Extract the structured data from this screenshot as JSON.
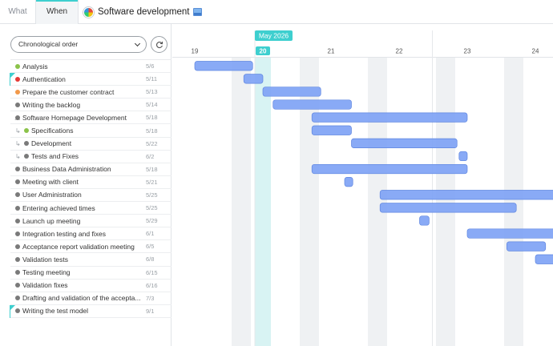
{
  "tabs": [
    {
      "label": "What"
    },
    {
      "label": "When"
    }
  ],
  "project": {
    "title": "Software development"
  },
  "left_panel": {
    "order_select": "Chronological order"
  },
  "timeline": {
    "month_label": "May 2026",
    "days": [
      "19",
      "20",
      "21",
      "22",
      "23",
      "24"
    ],
    "today": "20",
    "accent_color": "#3ecfcf",
    "bar_color": "#7fa3f5"
  },
  "tasks": [
    {
      "name": "Analysis",
      "date": "5/6",
      "dot": "#8bc34a",
      "start": 19.0,
      "end": 19.85
    },
    {
      "name": "Authentication",
      "date": "5/11",
      "dot": "#e53935",
      "flag": true,
      "start": 19.72,
      "end": 20.0
    },
    {
      "name": "Prepare the customer contract",
      "date": "5/13",
      "dot": "#f2994a",
      "start": 20.0,
      "end": 20.85
    },
    {
      "name": "Writing the backlog",
      "date": "5/14",
      "dot": "#7a7a7a",
      "start": 20.15,
      "end": 21.3
    },
    {
      "name": "Software Homepage Development",
      "date": "5/18",
      "dot": "#7a7a7a",
      "parent": true,
      "start": 20.72,
      "end": 23.0
    },
    {
      "name": "Specifications",
      "date": "5/18",
      "dot": "#8bc34a",
      "sub": true,
      "start": 20.72,
      "end": 21.3
    },
    {
      "name": "Development",
      "date": "5/22",
      "dot": "#7a7a7a",
      "sub": true,
      "start": 21.3,
      "end": 22.85
    },
    {
      "name": "Tests and Fixes",
      "date": "6/2",
      "dot": "#7a7a7a",
      "sub": true,
      "start": 22.88,
      "end": 23.0
    },
    {
      "name": "Business Data Administration",
      "date": "5/18",
      "dot": "#7a7a7a",
      "start": 20.72,
      "end": 23.0
    },
    {
      "name": "Meeting with client",
      "date": "5/21",
      "dot": "#7a7a7a",
      "start": 21.2,
      "end": 21.32
    },
    {
      "name": "User Administration",
      "date": "5/25",
      "dot": "#7a7a7a",
      "start": 21.72,
      "end": 24.95
    },
    {
      "name": "Entering achieved times",
      "date": "5/25",
      "dot": "#7a7a7a",
      "start": 21.72,
      "end": 23.72
    },
    {
      "name": "Launch up meeting",
      "date": "5/29",
      "dot": "#7a7a7a",
      "start": 22.3,
      "end": 22.44
    },
    {
      "name": "Integration testing and fixes",
      "date": "6/1",
      "dot": "#7a7a7a",
      "start": 23.0,
      "end": 25.4
    },
    {
      "name": "Acceptance report validation meeting",
      "date": "6/5",
      "dot": "#7a7a7a",
      "start": 23.58,
      "end": 24.15
    },
    {
      "name": "Validation tests",
      "date": "6/8",
      "dot": "#7a7a7a",
      "start": 24.0,
      "end": 24.72
    },
    {
      "name": "Testing meeting",
      "date": "6/15",
      "dot": "#7a7a7a"
    },
    {
      "name": "Validation fixes",
      "date": "6/16",
      "dot": "#7a7a7a"
    },
    {
      "name": "Drafting and validation of the accepta...",
      "date": "7/3",
      "dot": "#7a7a7a"
    },
    {
      "name": "Writing the test model",
      "date": "9/1",
      "dot": "#7a7a7a",
      "flag": true
    }
  ]
}
